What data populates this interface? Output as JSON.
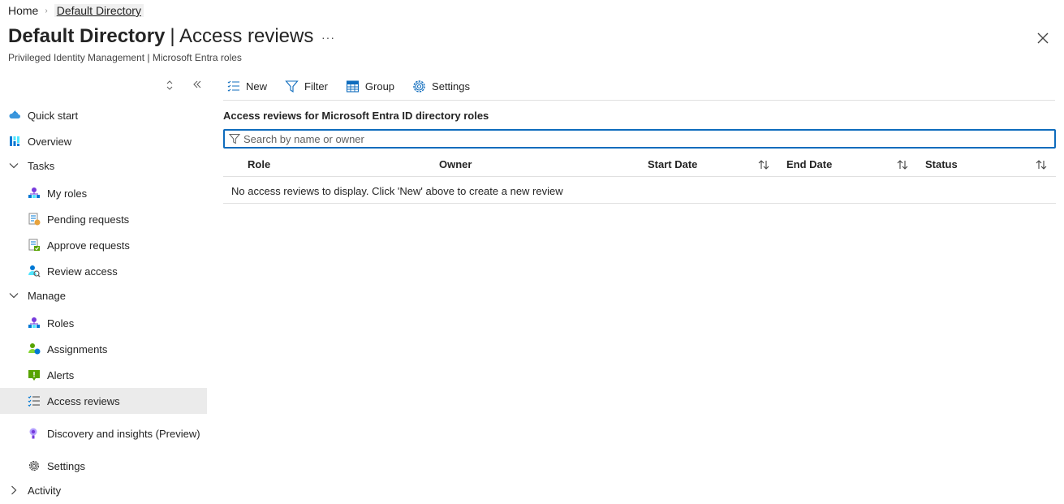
{
  "breadcrumb": {
    "home": "Home",
    "current": "Default Directory"
  },
  "header": {
    "title": "Default Directory",
    "separator": "|",
    "page": "Access reviews",
    "more": "···",
    "subtitle": "Privileged Identity Management | Microsoft Entra roles"
  },
  "sidebar": {
    "items": [
      {
        "label": "Quick start",
        "icon": "quick-start-cloud-icon",
        "type": "item",
        "level": 0
      },
      {
        "label": "Overview",
        "icon": "overview-grid-icon",
        "type": "item",
        "level": 0
      },
      {
        "label": "Tasks",
        "icon": "chevron-down-icon",
        "type": "group",
        "level": 0
      },
      {
        "label": "My roles",
        "icon": "my-roles-icon",
        "type": "item",
        "level": 1
      },
      {
        "label": "Pending requests",
        "icon": "pending-requests-icon",
        "type": "item",
        "level": 1
      },
      {
        "label": "Approve requests",
        "icon": "approve-requests-icon",
        "type": "item",
        "level": 1
      },
      {
        "label": "Review access",
        "icon": "review-access-icon",
        "type": "item",
        "level": 1
      },
      {
        "label": "Manage",
        "icon": "chevron-down-icon",
        "type": "group",
        "level": 0
      },
      {
        "label": "Roles",
        "icon": "roles-icon",
        "type": "item",
        "level": 1
      },
      {
        "label": "Assignments",
        "icon": "assignments-icon",
        "type": "item",
        "level": 1
      },
      {
        "label": "Alerts",
        "icon": "alerts-icon",
        "type": "item",
        "level": 1
      },
      {
        "label": "Access reviews",
        "icon": "access-reviews-icon",
        "type": "item",
        "level": 1,
        "selected": true
      },
      {
        "label": "Discovery and insights (Preview)",
        "icon": "discovery-insights-icon",
        "type": "item",
        "level": 1
      },
      {
        "label": "Settings",
        "icon": "gear-icon",
        "type": "item",
        "level": 1
      },
      {
        "label": "Activity",
        "icon": "chevron-right-icon",
        "type": "group",
        "level": 0
      }
    ]
  },
  "toolbar": {
    "new_label": "New",
    "filter_label": "Filter",
    "group_label": "Group",
    "settings_label": "Settings"
  },
  "main": {
    "section_title": "Access reviews for Microsoft Entra ID directory roles",
    "search_placeholder": "Search by name or owner",
    "columns": {
      "role": "Role",
      "owner": "Owner",
      "start_date": "Start Date",
      "end_date": "End Date",
      "status": "Status"
    },
    "empty_message": "No access reviews to display. Click 'New' above to create a new review"
  },
  "colors": {
    "accent": "#0f6cbd",
    "selected_bg": "#ebebeb",
    "text": "#242424"
  }
}
